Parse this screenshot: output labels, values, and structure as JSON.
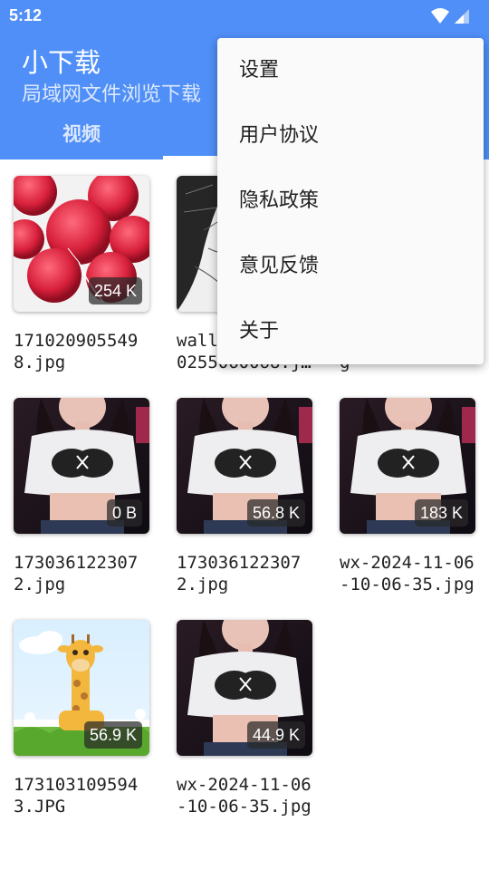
{
  "status_bar": {
    "time": "5:12"
  },
  "header": {
    "title": "小下载",
    "subtitle": "局域网文件浏览下载",
    "tabs": [
      {
        "label": "视频"
      },
      {
        "label": ""
      },
      {
        "label": ""
      }
    ]
  },
  "menu": {
    "items": [
      {
        "label": "设置"
      },
      {
        "label": "用户协议"
      },
      {
        "label": "隐私政策"
      },
      {
        "label": "意见反馈"
      },
      {
        "label": "关于"
      }
    ]
  },
  "files": [
    {
      "name": "1710209055498.jpg",
      "size": "254 K",
      "thumb": "radish-image"
    },
    {
      "name": "wallpaper-1710255060068.jpg",
      "size": "",
      "thumb": "tree-sketch-image"
    },
    {
      "name": "e7b7218eab.jpg",
      "size": "",
      "thumb": "photo-image"
    },
    {
      "name": "1730361223072.jpg",
      "size": "0 B",
      "thumb": "portrait-image"
    },
    {
      "name": "1730361223072.jpg",
      "size": "56.8 K",
      "thumb": "portrait-image"
    },
    {
      "name": "wx-2024-11-06-10-06-35.jpg",
      "size": "183 K",
      "thumb": "portrait-image"
    },
    {
      "name": "1731031095943.JPG",
      "size": "56.9 K",
      "thumb": "giraffe-cartoon-image"
    },
    {
      "name": "wx-2024-11-06-10-06-35.jpg",
      "size": "44.9 K",
      "thumb": "portrait-image"
    }
  ],
  "colors": {
    "primary": "#4f8ff7",
    "menu_bg": "#fafafa",
    "badge_bg": "#333333"
  }
}
